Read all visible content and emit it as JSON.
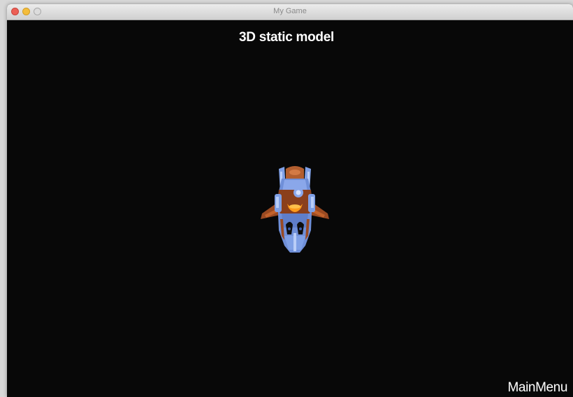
{
  "window": {
    "title": "My Game"
  },
  "scene": {
    "title": "3D static model",
    "model": "spaceship-model"
  },
  "menu": {
    "main_menu_label": "MainMenu"
  },
  "colors": {
    "background": "#080808",
    "ship_blue": "#7fa0e6",
    "ship_copper": "#9a4a22",
    "ship_glow": "#ff9a1a"
  }
}
